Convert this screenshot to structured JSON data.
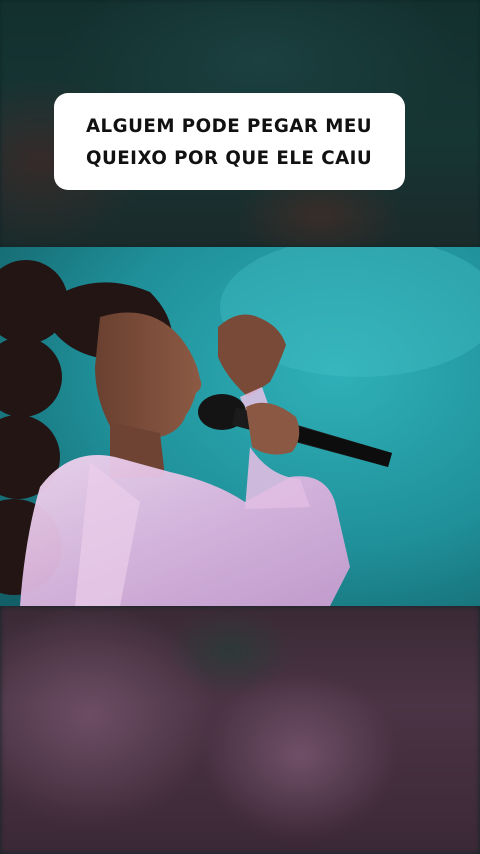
{
  "caption": {
    "lines": [
      "ALGUEM PODE PEGAR MEU",
      "QUEIXO POR QUE ELE CAIU"
    ],
    "background_color": "#ffffff",
    "text_color": "#111111"
  },
  "scene": {
    "stage_color": "#2aa3ad",
    "jacket_color": "#e4c3e6"
  }
}
